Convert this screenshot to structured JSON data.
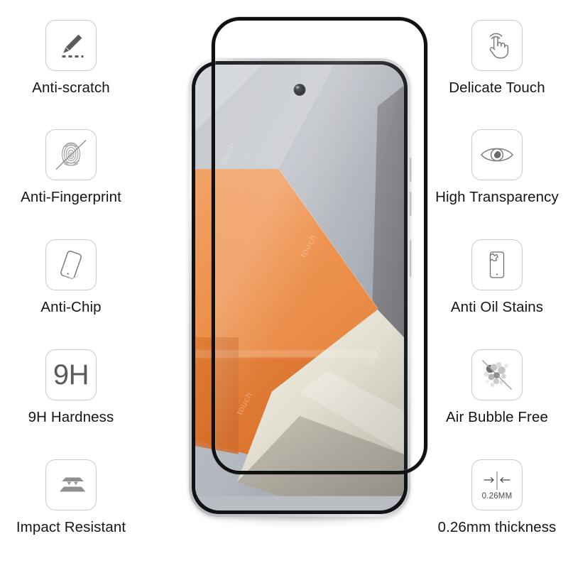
{
  "page": {
    "type": "product-infographic",
    "product": "tempered glass screen protector",
    "background_color": "#ffffff",
    "label_color": "#161616",
    "icon_border_color": "#c9c9c9"
  },
  "features_left": [
    {
      "label": "Anti-scratch",
      "icon": "pencil-scratch-icon"
    },
    {
      "label": "Anti-Fingerprint",
      "icon": "fingerprint-blocked-icon"
    },
    {
      "label": "Anti-Chip",
      "icon": "tilted-phone-icon"
    },
    {
      "label": "9H Hardness",
      "icon": "9h-text-icon",
      "icon_text": "9H"
    },
    {
      "label": "Impact Resistant",
      "icon": "layered-plates-icon"
    }
  ],
  "features_right": [
    {
      "label": "Delicate Touch",
      "icon": "tap-hand-icon"
    },
    {
      "label": "High Transparency",
      "icon": "eye-icon"
    },
    {
      "label": "Anti Oil Stains",
      "icon": "phone-oil-stain-icon"
    },
    {
      "label": "Air Bubble Free",
      "icon": "bubbles-blocked-icon"
    },
    {
      "label": "0.26mm thickness",
      "icon": "thickness-caliper-icon",
      "icon_text": "0.26MM"
    }
  ],
  "device": {
    "name": "smartphone-with-glass-protector",
    "screen_wallpaper": "abstract 3d orange wedge on grey planes",
    "camera": "punch-hole-front-camera",
    "wallpaper_colors": {
      "orange_light": "#f09a56",
      "orange_mid": "#e8823c",
      "orange_dark": "#c4561f",
      "grey_light": "#d2d5da",
      "grey_mid": "#9fa3ab",
      "grey_dark": "#6e7178",
      "cream": "#e7e2d6"
    },
    "glass_frame_color": "#111111",
    "watermark_text": "touch"
  }
}
